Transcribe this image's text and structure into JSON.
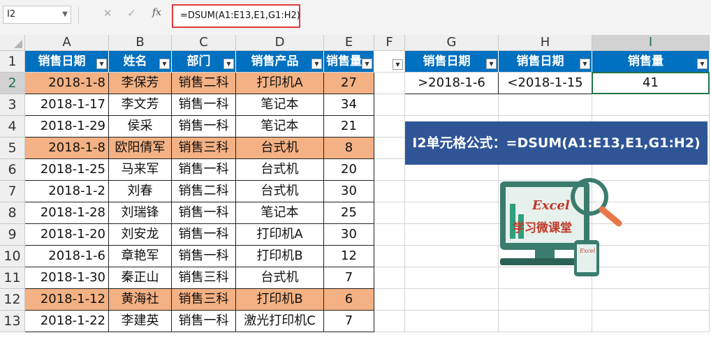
{
  "formula_bar": {
    "name_box": "I2",
    "cancel_icon": "✕",
    "enter_icon": "✓",
    "fx_label": "fx",
    "formula": "=DSUM(A1:E13,E1,G1:H2)"
  },
  "columns": [
    "A",
    "B",
    "C",
    "D",
    "E",
    "F",
    "G",
    "H",
    "I"
  ],
  "rows": [
    "1",
    "2",
    "3",
    "4",
    "5",
    "6",
    "7",
    "8",
    "9",
    "10",
    "11",
    "12",
    "13"
  ],
  "table": {
    "headers": [
      "销售日期",
      "姓名",
      "部门",
      "销售产品",
      "销售量"
    ],
    "data": [
      [
        "2018-1-8",
        "李保芳",
        "销售二科",
        "打印机A",
        "27"
      ],
      [
        "2018-1-17",
        "李文芳",
        "销售一科",
        "笔记本",
        "34"
      ],
      [
        "2018-1-29",
        "侯采",
        "销售一科",
        "笔记本",
        "21"
      ],
      [
        "2018-1-8",
        "欧阳倩军",
        "销售三科",
        "台式机",
        "8"
      ],
      [
        "2018-1-25",
        "马来军",
        "销售一科",
        "台式机",
        "20"
      ],
      [
        "2018-1-2",
        "刘春",
        "销售二科",
        "台式机",
        "30"
      ],
      [
        "2018-1-28",
        "刘瑞锋",
        "销售一科",
        "笔记本",
        "25"
      ],
      [
        "2018-1-20",
        "刘安龙",
        "销售一科",
        "打印机A",
        "30"
      ],
      [
        "2018-1-6",
        "章艳军",
        "销售一科",
        "打印机B",
        "12"
      ],
      [
        "2018-1-30",
        "秦正山",
        "销售三科",
        "台式机",
        "7"
      ],
      [
        "2018-1-12",
        "黄海社",
        "销售三科",
        "打印机B",
        "6"
      ],
      [
        "2018-1-22",
        "李建英",
        "销售一科",
        "激光打印机C",
        "7"
      ]
    ],
    "highlighted_rows": [
      0,
      3,
      10
    ]
  },
  "criteria": {
    "headers": [
      "销售日期",
      "销售日期",
      "销售量"
    ],
    "values": [
      ">2018-1-6",
      "<2018-1-15",
      "41"
    ]
  },
  "banner": "I2单元格公式：=DSUM(A1:E13,E1,G1:H2)",
  "logo": {
    "title": "Excel",
    "subtitle": "学习微课堂",
    "small": "Excel"
  },
  "colors": {
    "header_blue": "#0070c0",
    "highlight": "#f4b183",
    "banner": "#2f5597",
    "select_green": "#217346"
  }
}
